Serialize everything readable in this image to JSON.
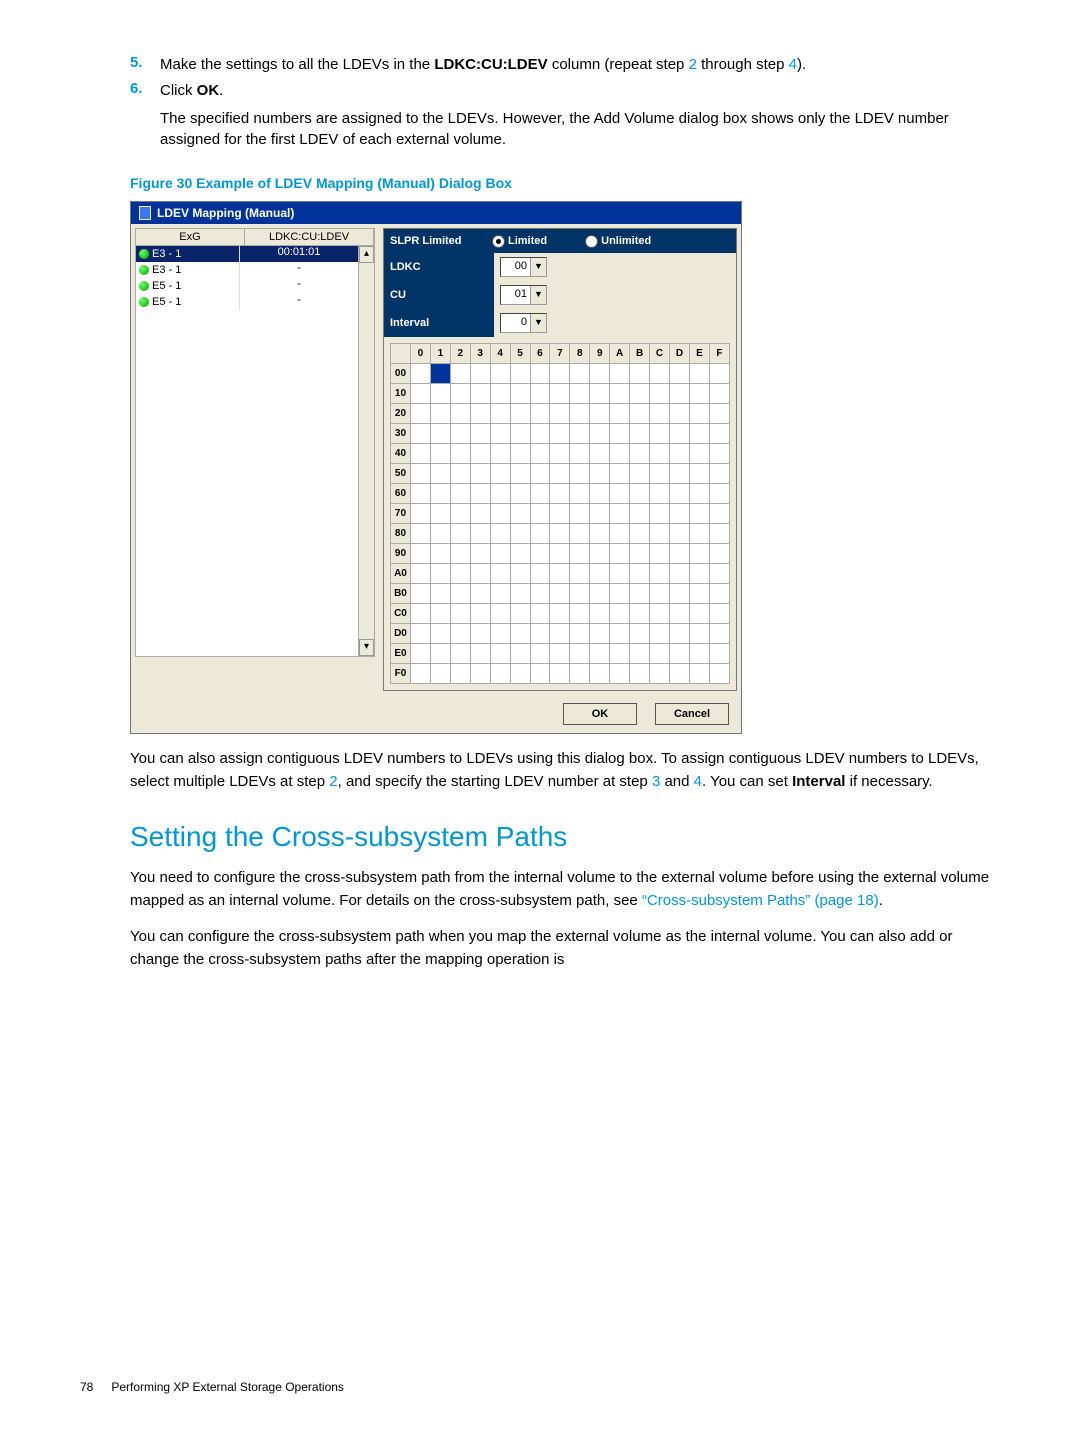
{
  "steps": {
    "s5": {
      "num": "5.",
      "text_a": "Make the settings to all the LDEVs in the ",
      "bold": "LDKC:CU:LDEV",
      "text_b": " column (repeat step ",
      "link1": "2",
      "text_c": " through step ",
      "link2": "4",
      "text_d": ")."
    },
    "s6": {
      "num": "6.",
      "line1_a": "Click ",
      "line1_b": "OK",
      "line1_c": ".",
      "line2": "The specified numbers are assigned to the LDEVs. However, the Add Volume dialog box shows only the LDEV number assigned for the first LDEV of each external volume."
    }
  },
  "figure_caption": "Figure 30 Example of LDEV Mapping (Manual) Dialog Box",
  "dialog": {
    "title": "LDEV Mapping (Manual)",
    "cols": {
      "exg": "ExG",
      "ldev": "LDKC:CU:LDEV"
    },
    "rows": [
      {
        "exg": "E3 - 1",
        "ldev": "00:01:01",
        "sel": true
      },
      {
        "exg": "E3 - 1",
        "ldev": "-",
        "sel": false
      },
      {
        "exg": "E5 - 1",
        "ldev": "-",
        "sel": false
      },
      {
        "exg": "E5 - 1",
        "ldev": "-",
        "sel": false
      }
    ],
    "slpr_label": "SLPR Limited",
    "radio_limited": "Limited",
    "radio_unlimited": "Unlimited",
    "ldkc_label": "LDKC",
    "ldkc_value": "00",
    "cu_label": "CU",
    "cu_value": "01",
    "interval_label": "Interval",
    "interval_value": "0",
    "grid_cols": [
      "0",
      "1",
      "2",
      "3",
      "4",
      "5",
      "6",
      "7",
      "8",
      "9",
      "A",
      "B",
      "C",
      "D",
      "E",
      "F"
    ],
    "grid_rows": [
      "00",
      "10",
      "20",
      "30",
      "40",
      "50",
      "60",
      "70",
      "80",
      "90",
      "A0",
      "B0",
      "C0",
      "D0",
      "E0",
      "F0"
    ],
    "filled_cell": {
      "row": "00",
      "col": "1"
    },
    "ok": "OK",
    "cancel": "Cancel"
  },
  "post_fig_para_a": "You can also assign contiguous LDEV numbers to LDEVs using this dialog box. To assign contiguous LDEV numbers to LDEVs, select multiple LDEVs at step ",
  "post_fig_link2": "2",
  "post_fig_para_b": ", and specify the starting LDEV number at step ",
  "post_fig_link3": "3",
  "post_fig_para_c": " and ",
  "post_fig_link4": "4",
  "post_fig_para_d": ". You can set ",
  "post_fig_bold": "Interval",
  "post_fig_para_e": " if necessary.",
  "section_heading": "Setting the Cross-subsystem Paths",
  "p2_a": "You need to configure the cross-subsystem path from the internal volume to the external volume before using the external volume mapped as an internal volume. For details on the cross-subsystem path, see ",
  "p2_link": "“Cross-subsystem Paths” (page 18)",
  "p2_b": ".",
  "p3": "You can configure the cross-subsystem path when you map the external volume as the internal volume. You can also add or change the cross-subsystem paths after the mapping operation is",
  "footer_page": "78",
  "footer_title": "Performing XP External Storage Operations"
}
